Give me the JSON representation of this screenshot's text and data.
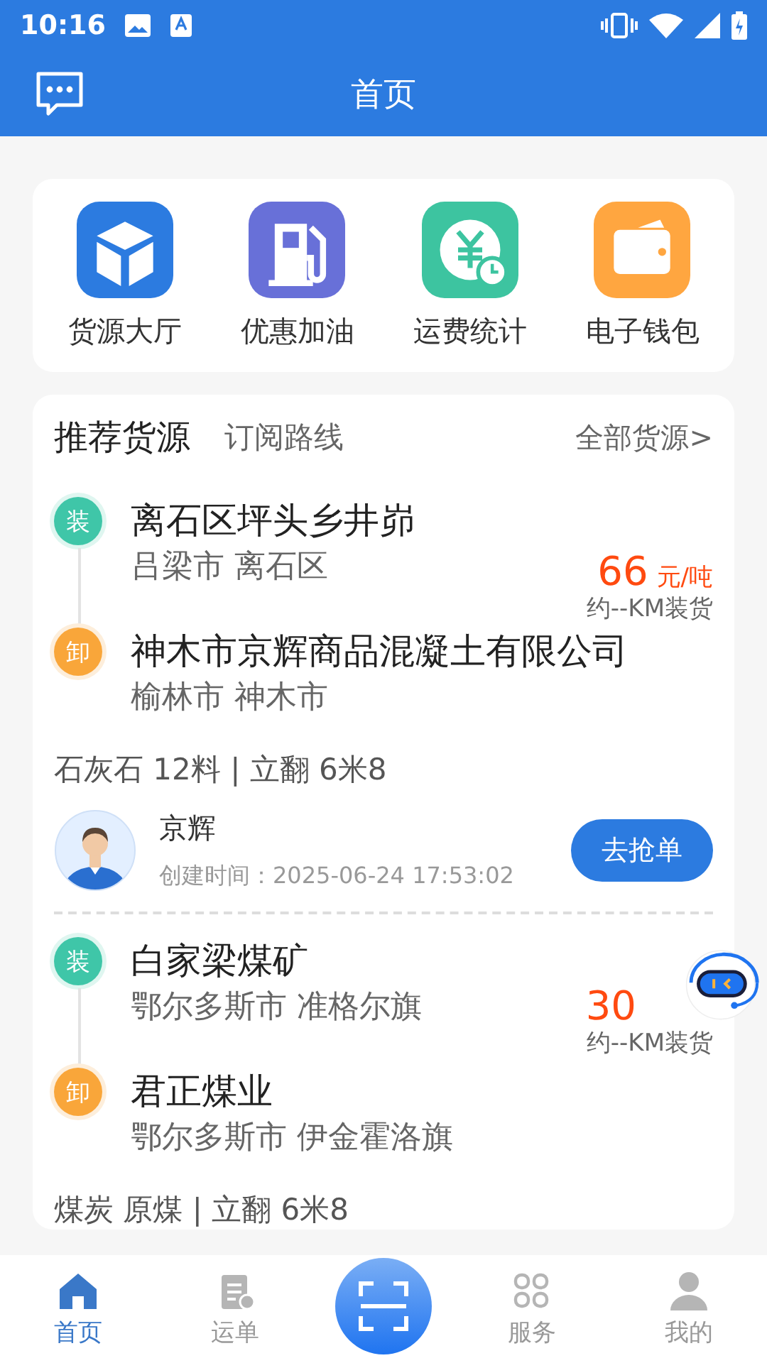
{
  "status_bar": {
    "time": "10:16"
  },
  "header": {
    "title": "首页"
  },
  "shortcuts": [
    {
      "label": "货源大厅",
      "kind": "box",
      "color": "#2c7be0"
    },
    {
      "label": "优惠加油",
      "kind": "fuel",
      "color": "#6870d8"
    },
    {
      "label": "运费统计",
      "kind": "fee",
      "color": "#3dc4a0"
    },
    {
      "label": "电子钱包",
      "kind": "wallet",
      "color": "#ffa640"
    }
  ],
  "section_tabs": [
    {
      "label": "推荐货源",
      "selected": true
    },
    {
      "label": "订阅路线",
      "selected": false
    }
  ],
  "all_link": "全部货源>",
  "orders": [
    {
      "stops": [
        {
          "kind": "load",
          "badge": "装",
          "place": "离石区坪头乡井峁",
          "region": "吕梁市 离石区"
        },
        {
          "kind": "unload",
          "badge": "卸",
          "place": "神木市京辉商品混凝土有限公司",
          "region": "榆林市 神木市"
        }
      ],
      "price": "66",
      "unit": "元/吨",
      "distance": "约--KM装货",
      "cargo": "石灰石 12料 | 立翻 6米8",
      "shipper": {
        "name": "京辉",
        "created": "创建时间：2025-06-24 17:53:02"
      },
      "action": "去抢单"
    },
    {
      "stops": [
        {
          "kind": "load",
          "badge": "装",
          "place": "白家梁煤矿",
          "region": "鄂尔多斯市 准格尔旗"
        },
        {
          "kind": "unload",
          "badge": "卸",
          "place": "君正煤业",
          "region": "鄂尔多斯市 伊金霍洛旗"
        }
      ],
      "price": "30",
      "distance": "约--KM装货",
      "cargo": "煤炭 原煤 | 立翻 6米8"
    }
  ],
  "bottom_nav": [
    {
      "kind": "home",
      "label": "首页",
      "selected": true
    },
    {
      "kind": "waybill",
      "label": "运单",
      "selected": false
    },
    {
      "kind": "scan",
      "selected": false
    },
    {
      "kind": "services",
      "label": "服务",
      "selected": false
    },
    {
      "kind": "profile",
      "label": "我的",
      "selected": false
    }
  ]
}
